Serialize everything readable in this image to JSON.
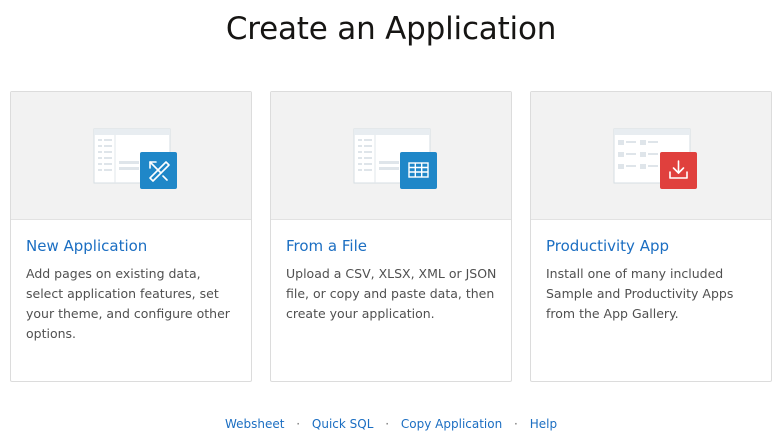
{
  "page": {
    "title": "Create an Application"
  },
  "cards": [
    {
      "title": "New Application",
      "description": "Add pages on existing data, select application features, set your theme, and configure other options.",
      "icon": "wand-pencil-icon",
      "badge_color": "#1f87c8"
    },
    {
      "title": "From a File",
      "description": "Upload a CSV, XLSX, XML or JSON file, or copy and paste data, then create your application.",
      "icon": "table-grid-icon",
      "badge_color": "#1f87c8"
    },
    {
      "title": "Productivity App",
      "description": "Install one of many included Sample and Productivity Apps from the App Gallery.",
      "icon": "download-icon",
      "badge_color": "#e0403d"
    }
  ],
  "footer": {
    "links": [
      "Websheet",
      "Quick SQL",
      "Copy Application",
      "Help"
    ],
    "separator": "·"
  }
}
